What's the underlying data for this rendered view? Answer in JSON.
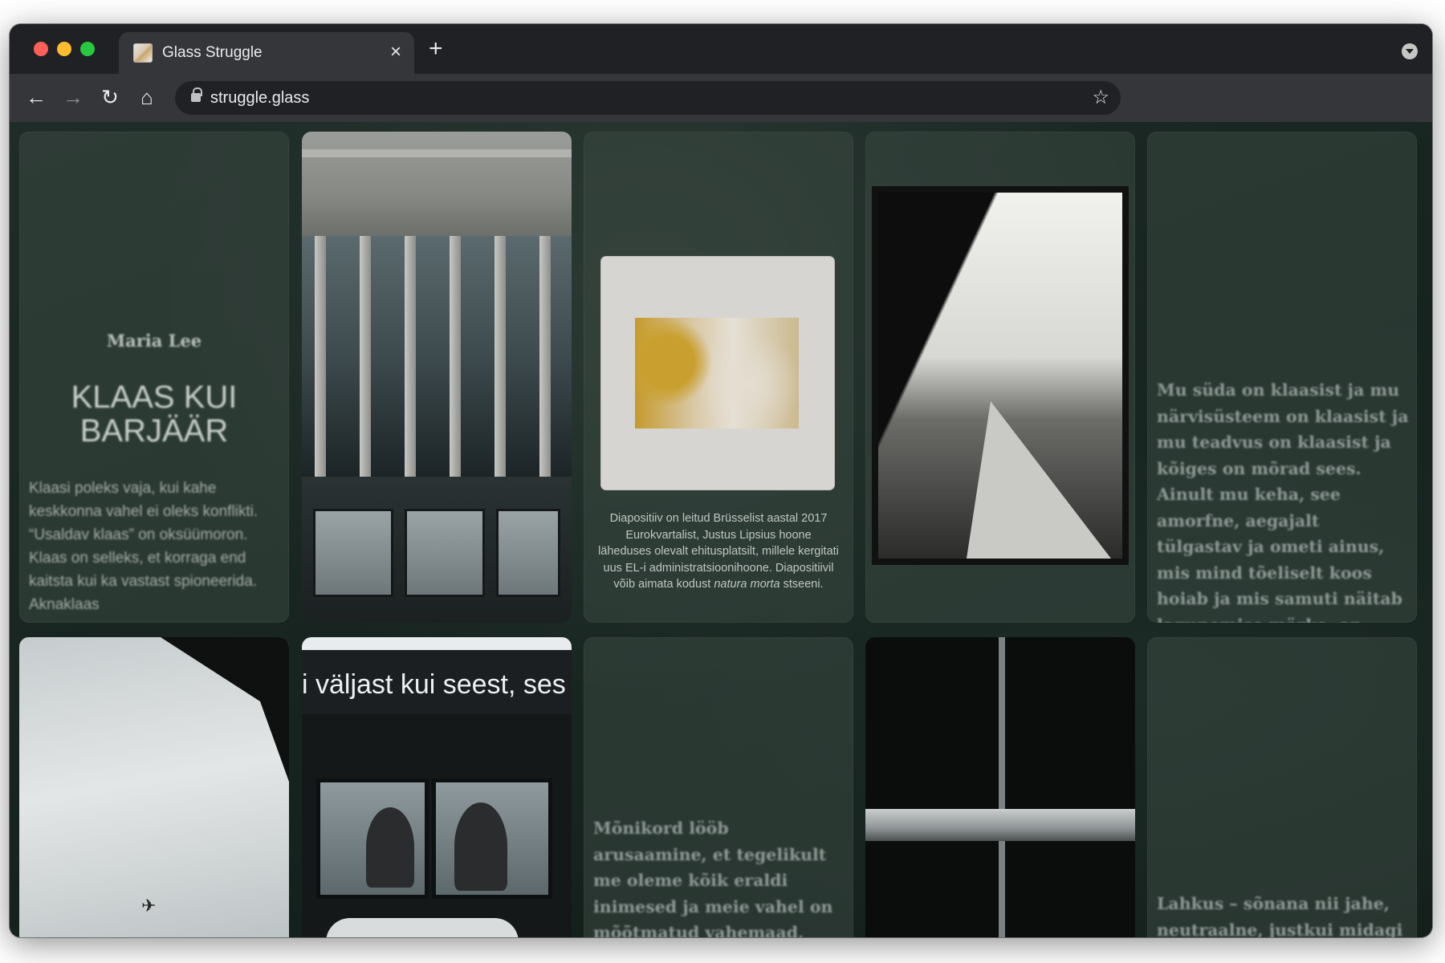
{
  "browser": {
    "tab_title": "Glass Struggle",
    "tab_close": "×",
    "new_tab": "+",
    "url": "struggle.glass",
    "back": "←",
    "forward": "→",
    "reload": "↻",
    "home": "⌂",
    "star": "☆"
  },
  "icons": {
    "favicon": "favicon-icon",
    "lock": "lock-icon",
    "star": "star-icon"
  },
  "cards": {
    "title_card": {
      "author": "Maria Lee",
      "title_line1": "KLAAS KUI",
      "title_line2": "BARJÄÄR",
      "body": "Klaasi poleks vaja, kui kahe keskkonna vahel ei oleks konflikti. “Usaldav klaas” on oksüümoron. Klaas on selleks, et korraga end kaitsta kui ka vastast spioneerida. Aknaklaas"
    },
    "slide_card": {
      "caption_main": "Diapositiiv on leitud Brüsselist aastal 2017 Eurokvartalist, Justus Lipsius hoone läheduses olevalt ehitusplatsilt, millele kergitati uus EL-i administratsioonihoone. Diapositiivil võib aimata kodust ",
      "caption_italic": "natura morta",
      "caption_end": " stseeni."
    },
    "poem_card_1": {
      "text": "Mu süda on klaasist ja mu närvisüsteem on klaasist ja mu teadvus on klaasist ja kõiges on mõrad sees. Ainult mu keha, see amorfne, aegajalt tülgastav ja ometi ainus, mis mind tõeliselt koos hoiab ja mis samuti näitab lagunemise märke, on põletamata savi ja vormitu"
    },
    "bus_card": {
      "banner": "i väljast kui seest, ses"
    },
    "poem_card_2": {
      "text": "Mõnikord lööb arusaamine, et tegelikult me oleme kõik eraldi inimesed ja meie vahel on mõõtmatud vahemaad, isegi kui me oleme kõige"
    },
    "poem_card_3": {
      "text": "Lahkus – sõnana nii jahe, neutraalne, justkui midagi"
    }
  }
}
